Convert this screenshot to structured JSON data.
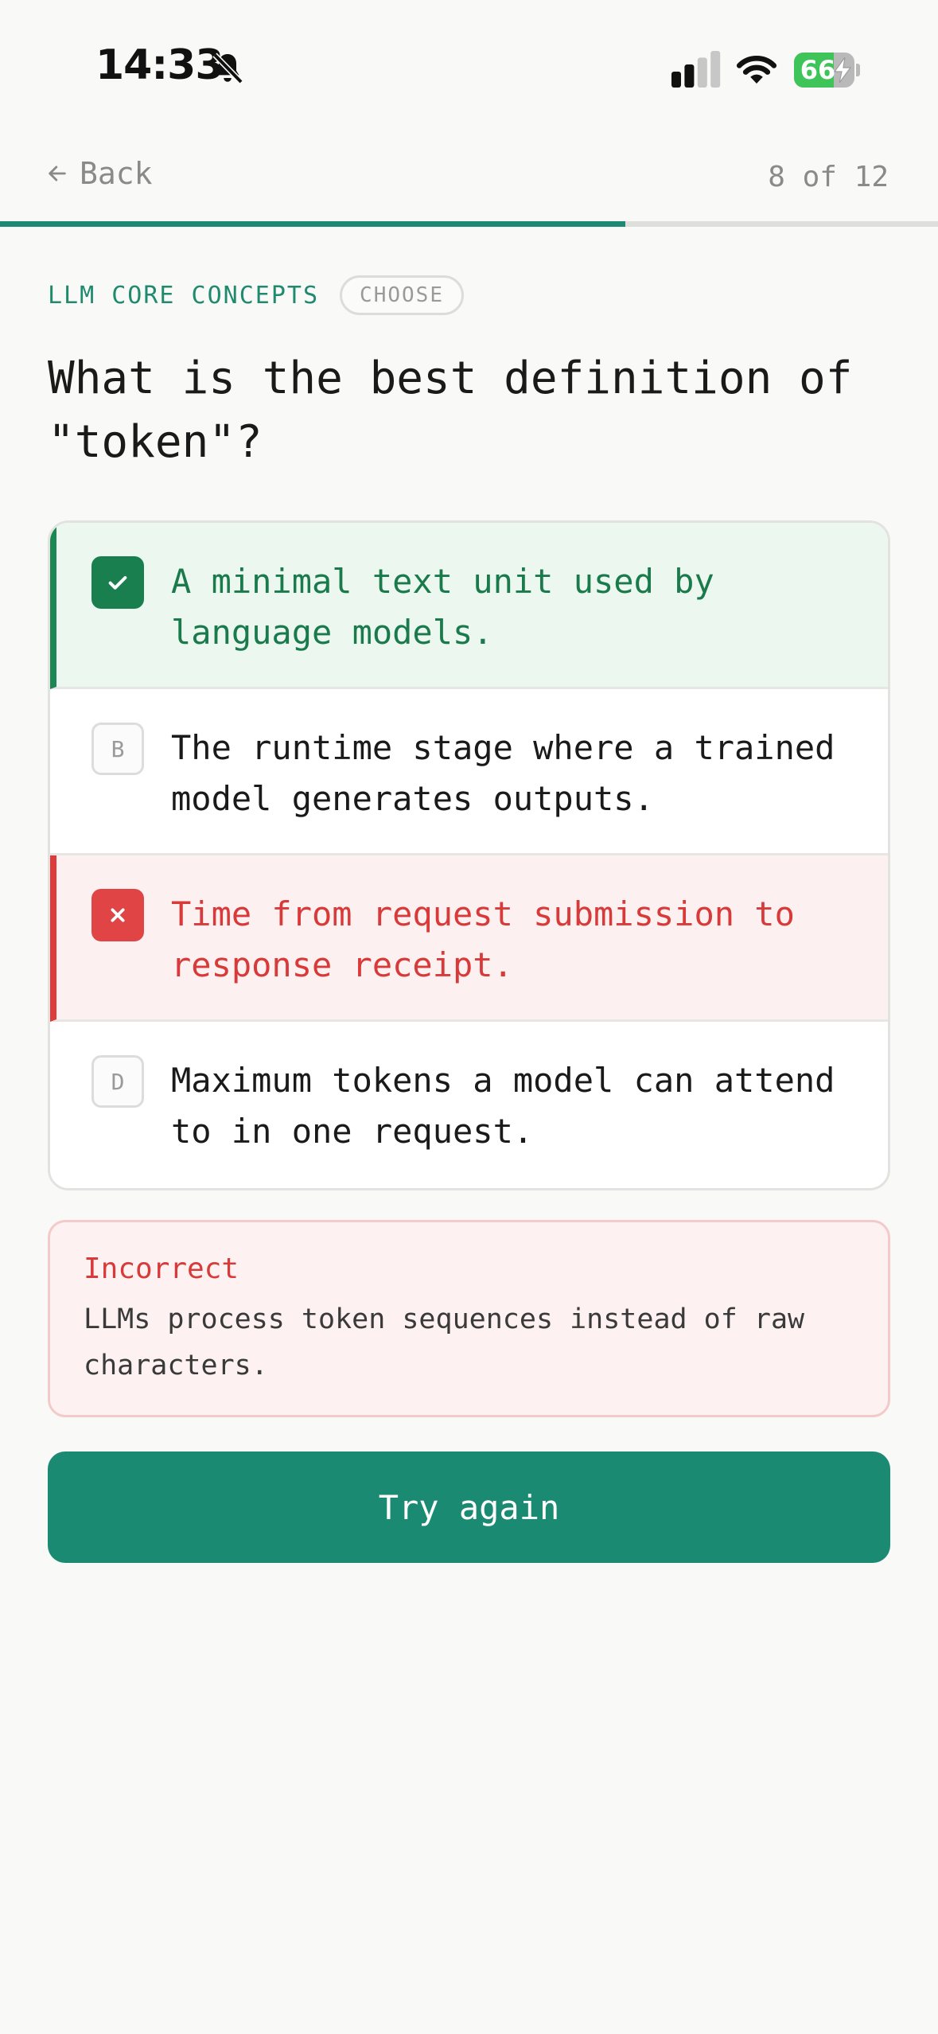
{
  "status_bar": {
    "time": "14:33",
    "battery_level": "66",
    "icons": [
      "bell-slash-icon",
      "cellular-signal-icon",
      "wifi-icon",
      "battery-charging-icon"
    ]
  },
  "nav": {
    "back_label": "Back",
    "counter": "8 of 12",
    "progress_fraction": 0.667
  },
  "quiz": {
    "category": "LLM CORE CONCEPTS",
    "tag": "CHOOSE",
    "question": "What is the best definition of \"token\"?",
    "options": [
      {
        "marker": "check",
        "text": "A minimal text unit used by language models.",
        "state": "correct"
      },
      {
        "marker": "B",
        "text": "The runtime stage where a trained model generates outputs.",
        "state": "neutral"
      },
      {
        "marker": "cross",
        "text": "Time from request submission to response receipt.",
        "state": "wrong"
      },
      {
        "marker": "D",
        "text": "Maximum tokens a model can attend to in one request.",
        "state": "neutral"
      }
    ]
  },
  "feedback": {
    "title": "Incorrect",
    "text": "LLMs process token sequences instead of raw characters."
  },
  "action": {
    "label": "Try again"
  },
  "colors": {
    "accent": "#1b8a72",
    "correct": "#1a7f4f",
    "wrong": "#e04444",
    "background": "#f9f9f7"
  }
}
